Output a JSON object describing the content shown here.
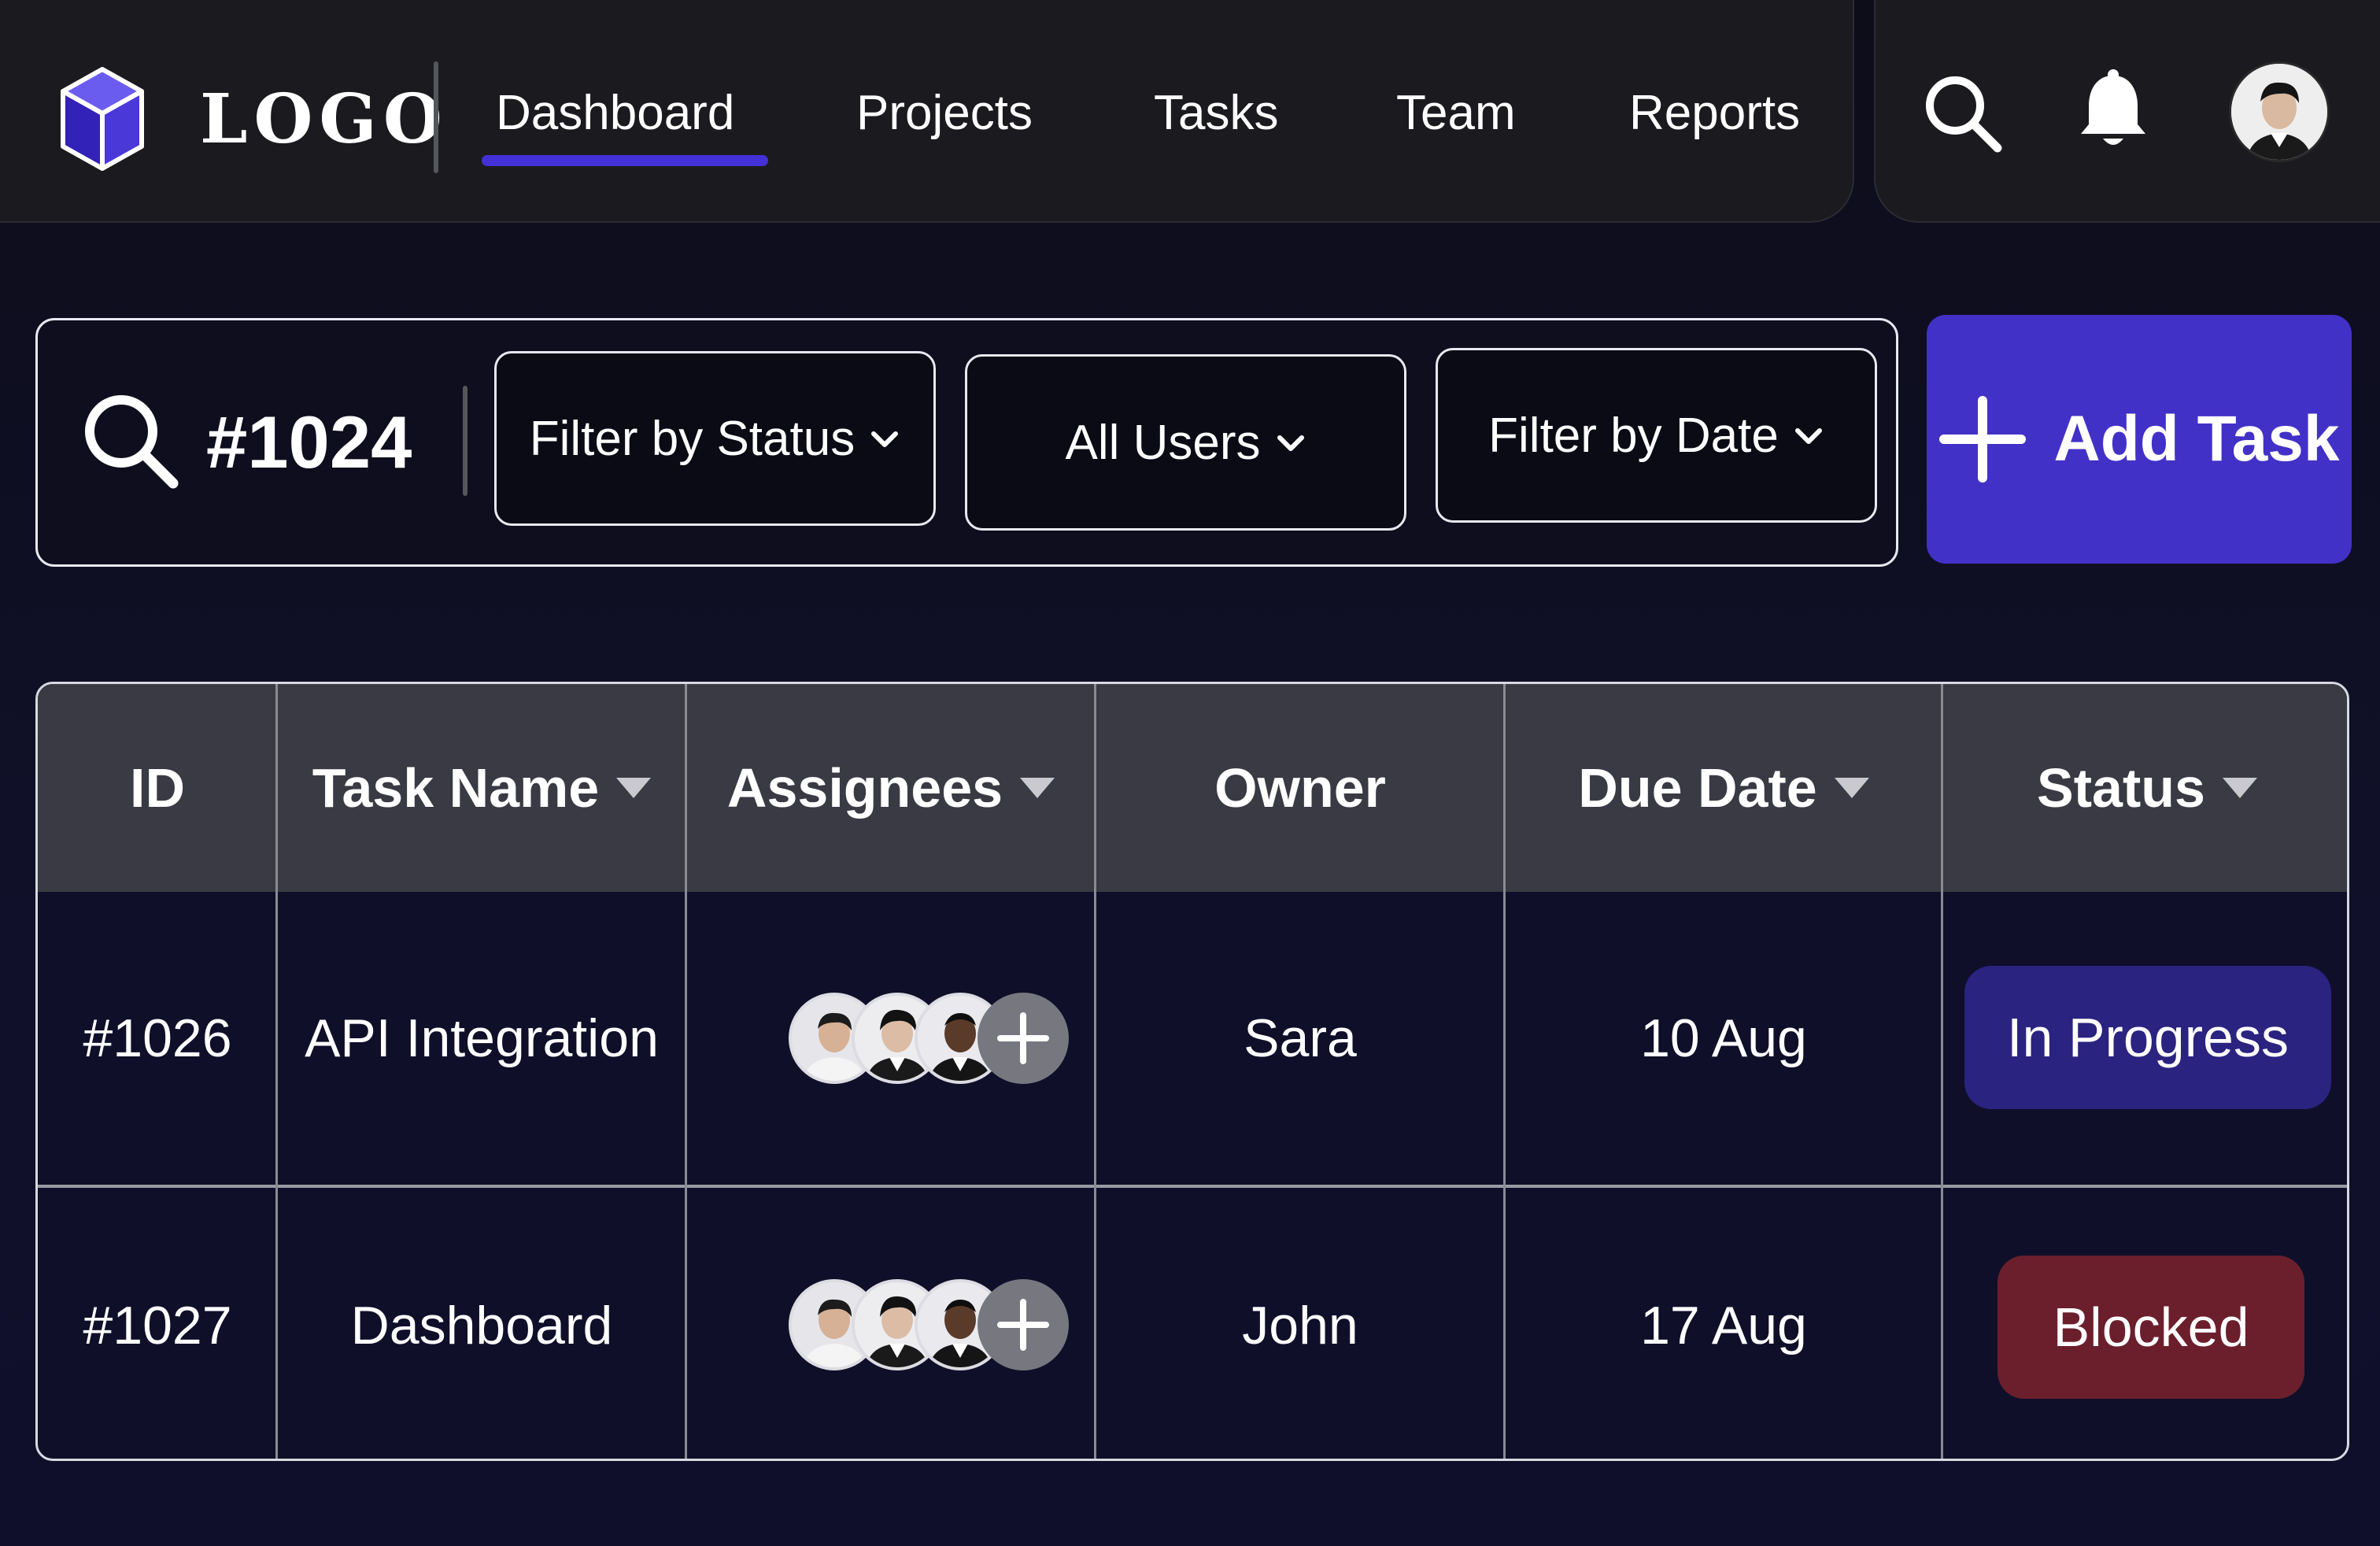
{
  "nav": {
    "logo_text": "LOGO",
    "links": [
      "Dashboard",
      "Projects",
      "Tasks",
      "Team",
      "Reports"
    ],
    "active": "Dashboard",
    "accent_color": "#4330d6"
  },
  "filters": {
    "search_value": "#1024",
    "status_label": "Filter by Status",
    "users_label": "All Users",
    "date_label": "Filter by Date",
    "add_button_label": "Add Task"
  },
  "table": {
    "headers": {
      "id": "ID",
      "task_name": "Task Name",
      "assignees": "Assignees",
      "owner": "Owner",
      "due_date": "Due Date",
      "status": "Status"
    },
    "rows": [
      {
        "id": "#1026",
        "task_name": "API Integration",
        "owner": "Sara",
        "due_date": "10 Aug",
        "status": "In Progress",
        "status_color": "#2a2380"
      },
      {
        "id": "#1027",
        "task_name": "Dashboard",
        "owner": "John",
        "due_date": "17 Aug",
        "status": "Blocked",
        "status_color": "#6b1f2c"
      }
    ]
  },
  "icons": [
    "cube-logo-icon",
    "search-icon",
    "bell-icon",
    "user-avatar",
    "chevron-down-icon",
    "plus-icon",
    "sort-triangle-icon"
  ]
}
